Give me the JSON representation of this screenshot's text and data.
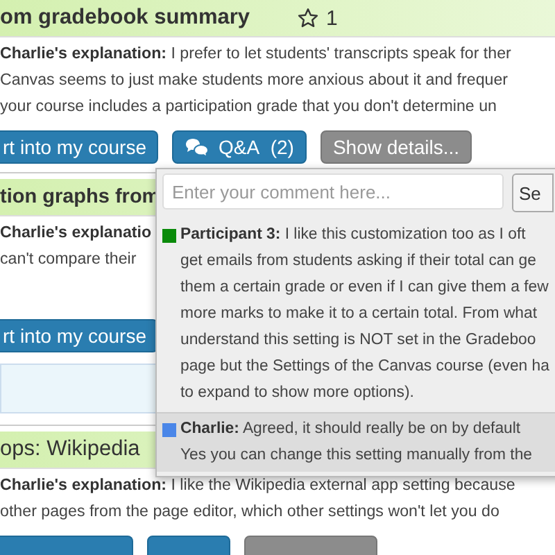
{
  "cards": [
    {
      "title": "om gradebook summary",
      "stars_count": "1",
      "explanation": "**Charlie's explanation:** I prefer to let students' transcripts speak for ther\nCanvas seems to just make students more anxious about it and frequer\nyour course includes a participation grade that you don't determine un",
      "buttons": [
        {
          "kind": "primary",
          "label": "rt into my course"
        },
        {
          "kind": "qa",
          "label": "Q&A",
          "count": "(2)"
        },
        {
          "kind": "secondary",
          "label": "Show details..."
        }
      ]
    },
    {
      "title": "tion graphs from",
      "explanation": "**Charlie's explanatio**\ncan't compare their",
      "buttons": [
        {
          "kind": "primary",
          "label": "rt into my course"
        }
      ],
      "panel": true
    },
    {
      "title": "ops:  Wikipedia",
      "explanation": "**Charlie's explanation:** I like the Wikipedia external app setting because\nother pages from the page editor, which other settings won't let you do",
      "buttons": [
        {
          "kind": "primary"
        },
        {
          "kind": "primary"
        },
        {
          "kind": "secondary"
        }
      ]
    }
  ],
  "popup": {
    "placeholder": "Enter your comment here...",
    "send_label": "Se",
    "comments": [
      {
        "color": "#0a8a0a",
        "highlighted": false,
        "text": "**Participant 3:** I like this customization too as I oft\nget emails from students asking if their total can ge\nthem a certain grade or even if I can give them a few\nmore marks to make it to a certain total. From what\nunderstand this setting is NOT set in the Gradeboo\npage but the Settings of the Canvas course (even ha\nto expand to show more options)."
      },
      {
        "color": "#4a86e8",
        "highlighted": true,
        "text": "**Charlie:** Agreed, it should really be on by default\nYes you can change this setting manually from the"
      }
    ]
  }
}
